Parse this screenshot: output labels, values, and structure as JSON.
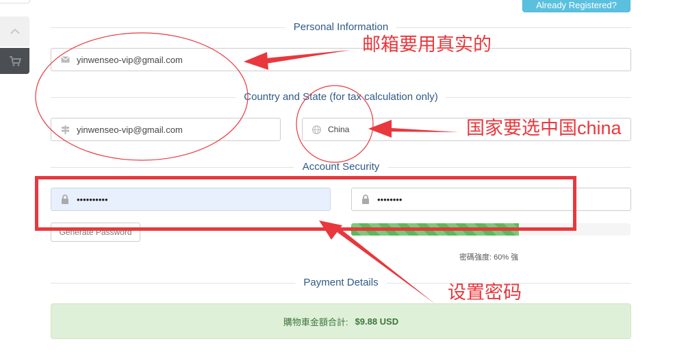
{
  "header": {
    "already_registered": "Already Registered?"
  },
  "sections": {
    "personal": "Personal Information",
    "country": "Country and State (for tax calculation only)",
    "security": "Account Security",
    "payment": "Payment Details"
  },
  "fields": {
    "email_value": "yinwenseo-vip@gmail.com",
    "state_value": "yinwenseo-vip@gmail.com",
    "country_value": "China",
    "password_value": "••••••••••",
    "confirm_value": "••••••••"
  },
  "security": {
    "generate_label": "Generate Password",
    "strength_fraction": 0.6,
    "strength_text": "密碼強度: 60% 強"
  },
  "payment": {
    "total_label": "購物車金額合計:",
    "total_amount": "$9.88 USD"
  },
  "annotations": {
    "email_note": "邮箱要用真实的",
    "country_note": "国家要选中国china",
    "password_note": "设置密码"
  },
  "colors": {
    "accent": "#2e5a84",
    "annotation": "#e8383d",
    "info_button": "#5bc0de",
    "success_bg": "#dff0d8",
    "strength_bar": "#5cb85c"
  }
}
